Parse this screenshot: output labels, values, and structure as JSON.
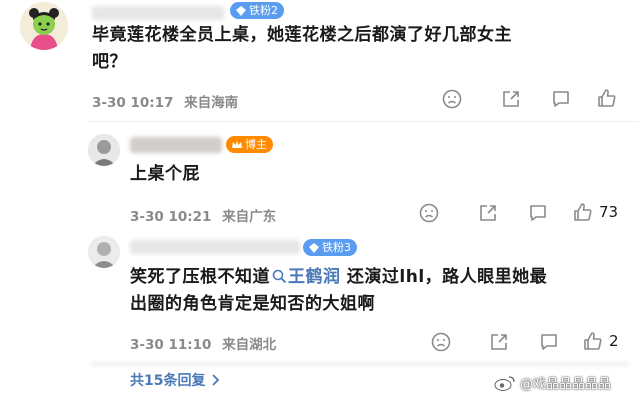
{
  "comments": [
    {
      "badge": "铁粉2",
      "text_line1": "毕竟莲花楼全员上桌，她莲花楼之后都演了好几部女主",
      "text_line2": "吧？",
      "time": "3-30 10:17",
      "location": "来自海南"
    },
    {
      "badge": "博主",
      "text": "上桌个屁",
      "time": "3-30 10:21",
      "location": "来自广东",
      "likes": "73"
    },
    {
      "badge": "铁粉3",
      "text_before": "笑死了压根不知道",
      "mention": "王鹤润",
      "text_after": " 还演过lhl，路人眼里她最",
      "text_line2": "出圈的角色肯定是知否的大姐啊",
      "time": "3-30 11:10",
      "location": "来自湖北",
      "likes": "2"
    }
  ],
  "more_replies": "共15条回复",
  "watermark": "@戏晶晶晶晶晶",
  "colors": {
    "link": "#4a78b8",
    "fan_badge": "#5a9cf0",
    "host_badge": "#ff8a00"
  }
}
